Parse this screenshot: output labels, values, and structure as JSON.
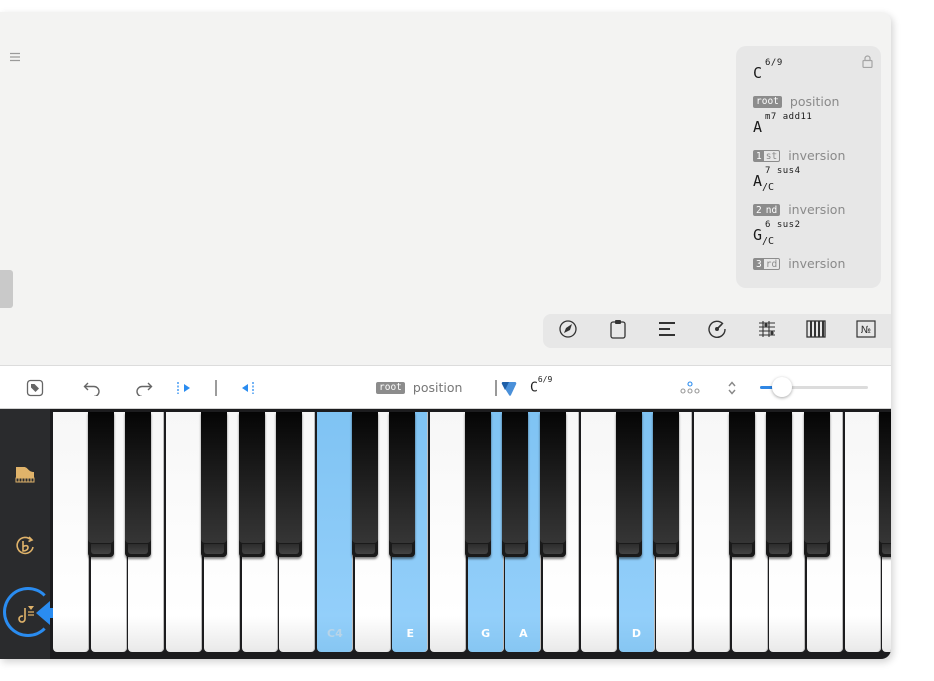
{
  "chord_panel": {
    "entries": [
      {
        "root": "C",
        "quality": "6/9",
        "bass": "",
        "badge": "root",
        "badge_prefix": "",
        "badge_suffix": "",
        "label": "position"
      },
      {
        "root": "A",
        "quality": "m7 add11",
        "bass": "",
        "badge": "",
        "badge_prefix": "1",
        "badge_suffix": "st",
        "label": "inversion"
      },
      {
        "root": "A",
        "quality": "7 sus4",
        "bass": "C",
        "badge": "",
        "badge_prefix": "2",
        "badge_suffix": "nd",
        "label": "inversion"
      },
      {
        "root": "G",
        "quality": "6 sus2",
        "bass": "C",
        "badge": "",
        "badge_prefix": "3",
        "badge_suffix": "rd",
        "label": "inversion"
      }
    ]
  },
  "tool_strip": {
    "tools": [
      "pencil-icon",
      "clipboard-icon",
      "align-lines-icon",
      "tempo-dial-icon",
      "tablature-icon",
      "piano-keys-icon",
      "number-sign-icon"
    ],
    "number_sign": "№"
  },
  "toolbar": {
    "badge": "root",
    "position_label": "position",
    "chord_root": "C",
    "chord_quality": "6/9",
    "zoom_level": 0.2
  },
  "keyboard": {
    "white_keys": [
      {
        "label": "",
        "on": false
      },
      {
        "label": "",
        "on": false
      },
      {
        "label": "",
        "on": false
      },
      {
        "label": "",
        "on": false
      },
      {
        "label": "",
        "on": false
      },
      {
        "label": "",
        "on": false
      },
      {
        "label": "",
        "on": false
      },
      {
        "label": "C4",
        "on": true
      },
      {
        "label": "",
        "on": false
      },
      {
        "label": "E",
        "on": true
      },
      {
        "label": "",
        "on": false
      },
      {
        "label": "G",
        "on": true
      },
      {
        "label": "A",
        "on": true
      },
      {
        "label": "",
        "on": false
      },
      {
        "label": "",
        "on": false
      },
      {
        "label": "D",
        "on": true
      },
      {
        "label": "",
        "on": false
      },
      {
        "label": "",
        "on": false
      },
      {
        "label": "",
        "on": false
      },
      {
        "label": "",
        "on": false
      },
      {
        "label": "",
        "on": false
      },
      {
        "label": "",
        "on": false
      },
      {
        "label": "",
        "on": false
      }
    ],
    "black_after_white": [
      0,
      1,
      3,
      4,
      5,
      7,
      8,
      10,
      11,
      12,
      14,
      15,
      17,
      18,
      19,
      21
    ]
  },
  "side_rail": {
    "buttons": [
      "grand-piano-icon",
      "flat-cycle-icon",
      "note-input-icon"
    ]
  },
  "colors": {
    "accent": "#2a8cf0",
    "key_highlight": "#93cffa"
  }
}
